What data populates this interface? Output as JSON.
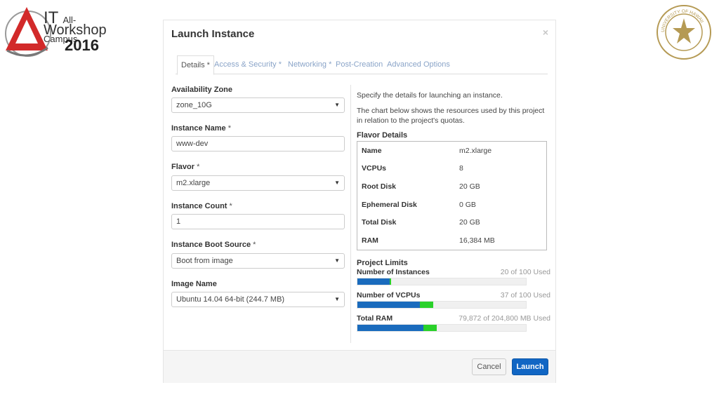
{
  "logos": {
    "workshop": {
      "line1_it": "IT",
      "line1_rest": "All-Campus",
      "line2": "Workshop",
      "line3": "2016"
    },
    "seal": {
      "text": "UNIVERSITY OF HAWAII"
    }
  },
  "modal": {
    "title": "Launch Instance",
    "close": "×",
    "tabs": [
      {
        "label": "Details *",
        "active": true
      },
      {
        "label": "Access & Security *"
      },
      {
        "label": "Networking *"
      },
      {
        "label": "Post-Creation"
      },
      {
        "label": "Advanced Options"
      }
    ],
    "form": {
      "availability_zone": {
        "label": "Availability Zone",
        "value": "zone_10G"
      },
      "instance_name": {
        "label": "Instance Name",
        "required": "*",
        "value": "www-dev"
      },
      "flavor": {
        "label": "Flavor",
        "required": "*",
        "value": "m2.xlarge"
      },
      "instance_count": {
        "label": "Instance Count",
        "required": "*",
        "value": "1"
      },
      "boot_source": {
        "label": "Instance Boot Source",
        "required": "*",
        "value": "Boot from image"
      },
      "image_name": {
        "label": "Image Name",
        "value": "Ubuntu 14.04 64-bit (244.7 MB)"
      }
    },
    "info": {
      "desc1": "Specify the details for launching an instance.",
      "desc2": "The chart below shows the resources used by this project in relation to the project's quotas.",
      "flavor_title": "Flavor Details",
      "flavor_rows": [
        {
          "name": "Name",
          "value": "m2.xlarge"
        },
        {
          "name": "VCPUs",
          "value": "8"
        },
        {
          "name": "Root Disk",
          "value": "20 GB"
        },
        {
          "name": "Ephemeral Disk",
          "value": "0 GB"
        },
        {
          "name": "Total Disk",
          "value": "20 GB"
        },
        {
          "name": "RAM",
          "value": "16,384 MB"
        }
      ],
      "limits_title": "Project Limits",
      "limits": [
        {
          "label": "Number of Instances",
          "used_text": "20 of 100 Used",
          "used_fraction": 0.19,
          "added_fraction": 0.01
        },
        {
          "label": "Number of VCPUs",
          "used_text": "37 of 100 Used",
          "used_fraction": 0.37,
          "added_fraction": 0.08
        },
        {
          "label": "Total RAM",
          "used_text": "79,872 of 204,800 MB Used",
          "used_fraction": 0.39,
          "added_fraction": 0.08
        }
      ]
    },
    "footer": {
      "cancel": "Cancel",
      "launch": "Launch"
    }
  },
  "colors": {
    "bar_used": "#1a6bbd",
    "bar_added": "#2ad12a",
    "launch_btn": "#1166c4",
    "tab_link": "#8aa4c8"
  }
}
